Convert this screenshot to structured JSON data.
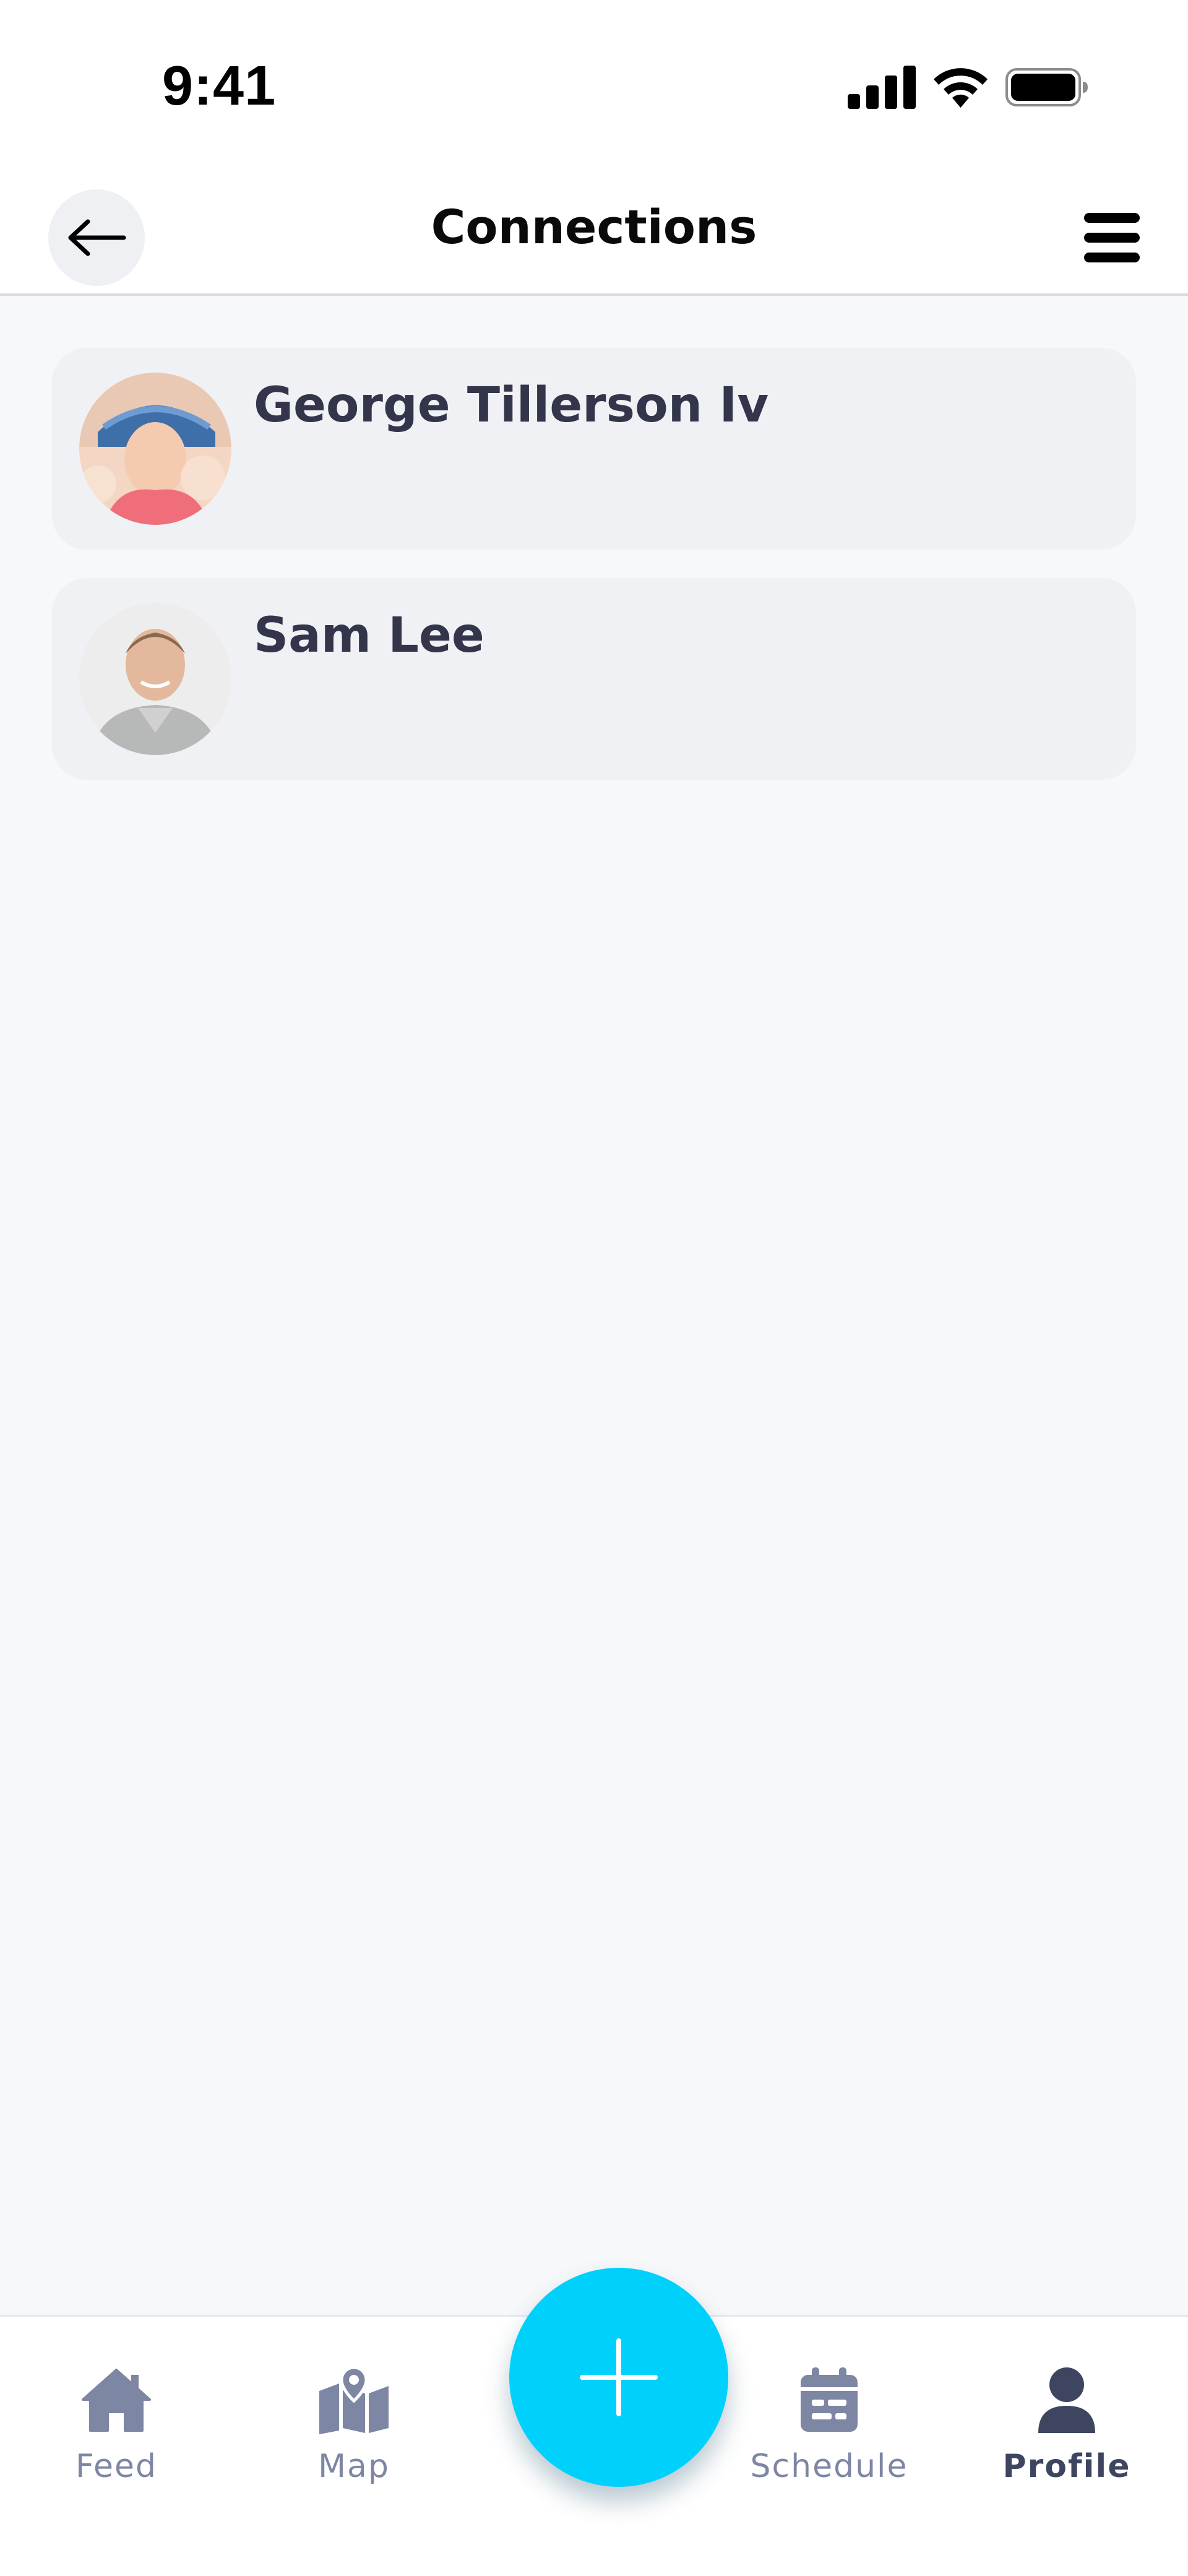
{
  "status_bar": {
    "time": "9:41"
  },
  "header": {
    "title": "Connections",
    "back_icon": "arrow-left-icon",
    "menu_icon": "hamburger-menu-icon"
  },
  "connections": [
    {
      "name": "George Tillerson Iv",
      "avatar_icon": "avatar-photo"
    },
    {
      "name": "Sam Lee",
      "avatar_icon": "avatar-photo"
    }
  ],
  "bottom_nav": {
    "items": [
      {
        "label": "Feed",
        "icon": "home-icon",
        "active": false
      },
      {
        "label": "Map",
        "icon": "map-icon",
        "active": false
      },
      {
        "label": "Schedule",
        "icon": "calendar-icon",
        "active": false
      },
      {
        "label": "Profile",
        "icon": "user-icon",
        "active": true
      }
    ],
    "fab_icon": "plus-icon"
  },
  "colors": {
    "accent": "#00D1FC",
    "nav_inactive": "#7D86A3",
    "nav_active": "#3D4560",
    "card_bg": "#F0F1F5",
    "page_bg": "#F7F8FA"
  }
}
